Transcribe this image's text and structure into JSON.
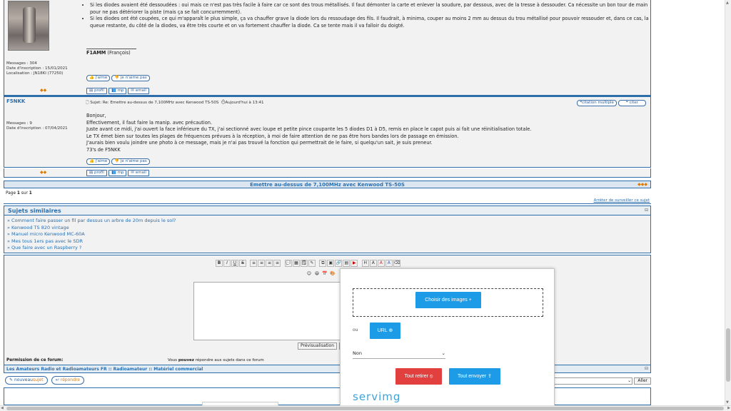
{
  "post1": {
    "bullets": [
      "Si les diodes avaient été dessoudées : oui mais ce n'est pas très facile à faire car ce sont des trous métallisés. Il faut démonter la carte et enlever la soudure, par dessous, avec de la tresse à dessouder. Ca nécessite un bon tour de main pour ne pas détériorer la piste (mais ça se fait concurremment).",
      "Si les diodes ont été coupées, ce qui m'apparaît le plus simple, ça va chauffer grave la diode lors du ressoudage des fils. Il faudrait, à minima, couper au moins 2 mm au dessus du trou métallisé pour pouvoir ressouder et, dans ce cas, la queue restante, du côté de la diodes, va être très courte et on va fortement chauffer la diode. Ca se tente mais il va falloir du doigté."
    ],
    "signature": "F1AMM",
    "signature_rest": " (François)",
    "meta": [
      "Messages : 304",
      "Date d'inscription : 15/01/2021",
      "Localisation : JN18KI (77250)"
    ],
    "like": "j'aime",
    "dislike": "je n'aime pas",
    "profile": "profil",
    "mp": "mp",
    "email": "email"
  },
  "post2": {
    "author": "F5NKK",
    "subject": "Sujet: Re: Emettre au-dessus de 7,100MHz avec Kenwood TS-50S",
    "date": "Aujourd'hui à 13:41",
    "quote_multi": "citation multiple",
    "quote": "citer",
    "meta": [
      "Messages : 9",
      "Date d'inscription : 07/04/2021"
    ],
    "lines": [
      "Bonjour,",
      "Effectivement, il faut faire la manip. avec précaution.",
      "Juste avant ce midi, j'ai ouvert la face inférieure du TX, j'ai sectionné avec loupe et petite pince coupante les 5 diodes D1 à D5, remis en place le capot puis ai fait une réinitialisation totale.",
      "Le TX émet bien sur toutes les plages de fréquences prévues à la réception, à moi de faire attention de ne pas être hors bandes lors de passage en émission.",
      "J'aurais bien voulu joindre une photo à ce message, mais je n'ai pas trouvé la fonction qui permettrait de le faire, si quelqu'un sait, je suis preneur.",
      "73's de F5NKK"
    ],
    "like": "j'aime",
    "dislike": "je n'aime pas",
    "profile": "profil",
    "mp": "mp",
    "email": "email"
  },
  "topic_title": "Emettre au-dessus de 7,100MHz avec Kenwood TS-50S",
  "page_prefix": "Page ",
  "page_num": "1",
  "page_mid": " sur ",
  "page_total": "1",
  "stop_watch": "Arrêter de surveiller ce sujet",
  "similar": {
    "title": "Sujets similaires",
    "items": [
      "» Comment faire passer un fil par dessus un arbre de 20m depuis le sol?",
      "» Kenwood TS 820 vintage",
      "» Manuel micro Kenwood MC-60A",
      "» Mes tous 1ers pas avec le SDR",
      "» Que faire avec un Raspberry ?"
    ]
  },
  "editor": {
    "preview": "Prévisualisation"
  },
  "permission_label": "Permission de ce forum:",
  "permission_text_a": "Vous ",
  "permission_text_b": "pouvez",
  "permission_text_c": " répondre aux sujets dans ce forum",
  "breadcrumb": "Les Amateurs Radio et Radioamateurs FR :: Radioamateur :: Matériel commercial",
  "new_topic": "nouveau",
  "new_topic_b": "sujet",
  "reply": "répondre",
  "go": "Aller",
  "upload": {
    "choose_images": "Choisir des images",
    "or": "ou",
    "url": "URL",
    "select_value": "Non",
    "remove_all": "Tout retirer",
    "send_all": "Tout envoyer",
    "brand": "servimg"
  }
}
